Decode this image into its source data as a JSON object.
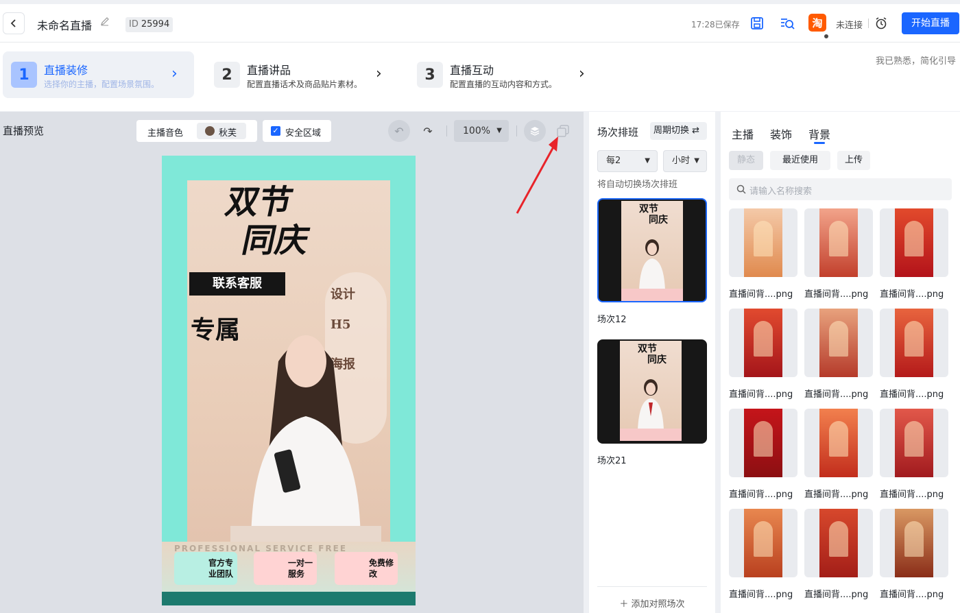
{
  "header": {
    "back_icon": "chevron-left-icon",
    "title": "未命名直播",
    "id_label": "ID",
    "id_value": "25994",
    "saved_text": "17:28已保存",
    "platform_glyph": "淘",
    "connection_status": "未连接",
    "start_button": "开始直播"
  },
  "steps": [
    {
      "num": "1",
      "title": "直播装修",
      "desc": "选择你的主播，配置场景氛围。",
      "active": true
    },
    {
      "num": "2",
      "title": "直播讲品",
      "desc": "配置直播话术及商品贴片素材。",
      "active": false
    },
    {
      "num": "3",
      "title": "直播互动",
      "desc": "配置直播的互动内容和方式。",
      "active": false
    }
  ],
  "skip_text": "我已熟悉，简化引导",
  "preview": {
    "title": "直播预览",
    "voice_label": "主播音色",
    "voice_name": "秋芙",
    "safe_area_label": "安全区域",
    "safe_area_checked": true,
    "zoom": "100%"
  },
  "poster": {
    "title_line1": "双节",
    "title_line2": "同庆",
    "contact": "联系客服",
    "exclusive": "专属",
    "pill_items": [
      "设计",
      "H5",
      "海报"
    ],
    "professional": "PROFESSIONAL  SERVICE  FREE",
    "features": [
      "官方专业团队",
      "一对一服务",
      "免费修改"
    ]
  },
  "schedule": {
    "title": "场次排班",
    "cycle_button": "周期切换 ⇄",
    "every_select": "每2",
    "unit_select": "小时",
    "hint": "将自动切换场次排班",
    "scenes": [
      {
        "name": "场次12",
        "selected": true
      },
      {
        "name": "场次21",
        "selected": false
      }
    ],
    "add_scene": "＋  添加对照场次"
  },
  "assets": {
    "tabs": [
      "主播",
      "装饰",
      "背景"
    ],
    "active_tab": "背景",
    "filters": [
      "静态",
      "最近使用",
      "上传"
    ],
    "search_placeholder": "请输入名称搜索",
    "items": [
      {
        "name": "直播间背....png",
        "palette": [
          "#f4c9a8",
          "#e08a4e"
        ]
      },
      {
        "name": "直播间背....png",
        "palette": [
          "#f2a48a",
          "#c2402c"
        ]
      },
      {
        "name": "直播间背....png",
        "palette": [
          "#e24a2c",
          "#b3131a"
        ]
      },
      {
        "name": "直播间背....png",
        "palette": [
          "#e14a2f",
          "#a4151a"
        ]
      },
      {
        "name": "直播间背....png",
        "palette": [
          "#e8a27d",
          "#b53a2a"
        ]
      },
      {
        "name": "直播间背....png",
        "palette": [
          "#e8643e",
          "#b41a1a"
        ]
      },
      {
        "name": "直播间背....png",
        "palette": [
          "#c5151a",
          "#8c0f12"
        ]
      },
      {
        "name": "直播间背....png",
        "palette": [
          "#f2804e",
          "#c22d1c"
        ]
      },
      {
        "name": "直播间背....png",
        "palette": [
          "#e2584a",
          "#a11a1e"
        ]
      },
      {
        "name": "直播间背....png",
        "palette": [
          "#e8874f",
          "#b9401f"
        ]
      },
      {
        "name": "直播间背....png",
        "palette": [
          "#d7482c",
          "#a31e18"
        ]
      },
      {
        "name": "直播间背....png",
        "palette": [
          "#d99863",
          "#8a2d18"
        ]
      }
    ]
  },
  "colors": {
    "accent": "#1a66ff",
    "canvas_bg": "#7fe8d8"
  }
}
